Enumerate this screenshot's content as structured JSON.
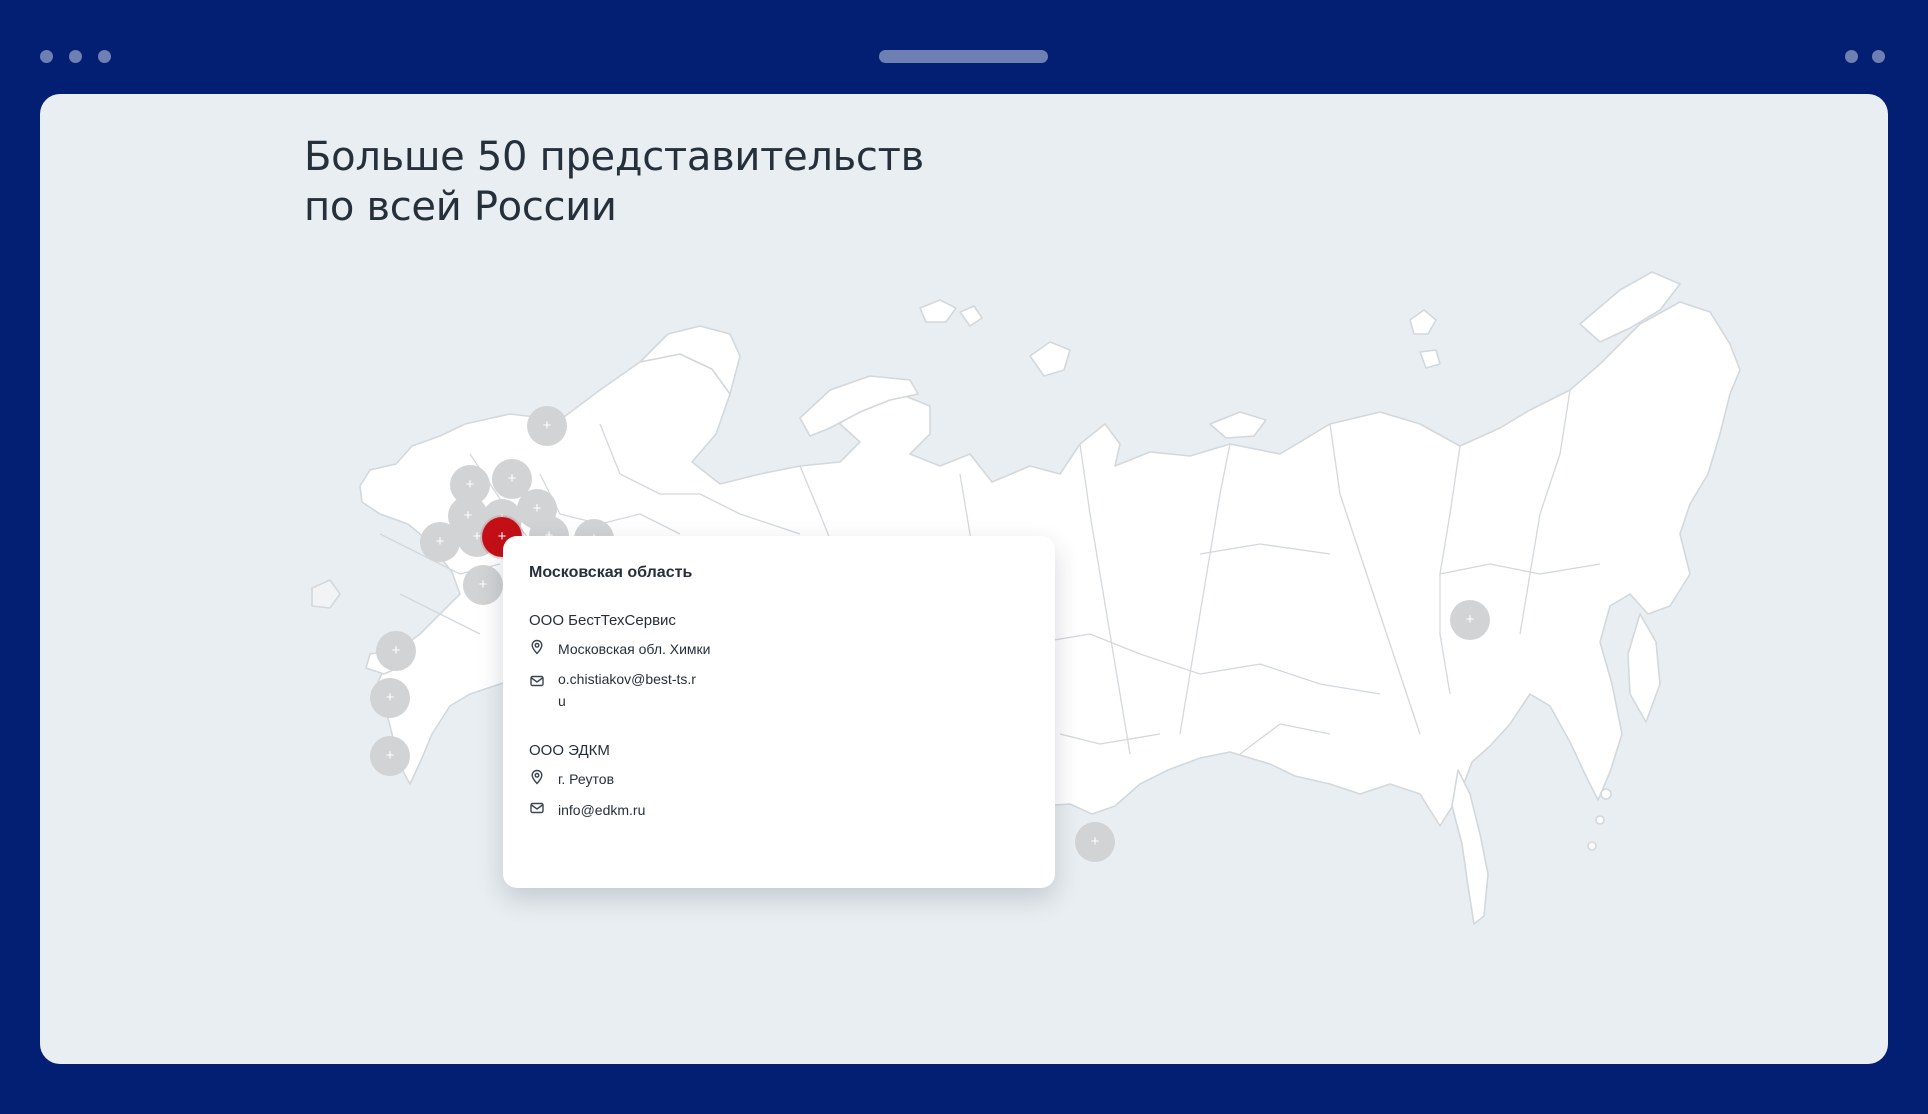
{
  "browser": {
    "controls": [
      "dot",
      "dot",
      "dot"
    ]
  },
  "page": {
    "heading_line1": "Больше 50 представительств",
    "heading_line2": "по всей России"
  },
  "map": {
    "markers_total": 16,
    "active_marker_region": "Московская область",
    "marker_icon": "plus-icon",
    "colors": {
      "land": "#ffffff",
      "border": "#d3d8dc",
      "marker": "#d1d3d5",
      "active": "#c40f17",
      "background": "#e8eef1"
    }
  },
  "popup": {
    "title": "Московская область",
    "companies": [
      {
        "name": "ООО БестТехСервис",
        "address": "Московская обл. Химки",
        "email": "o.chistiakov@best-ts.ru"
      },
      {
        "name": "ООО ЭДКМ",
        "address": "г. Реутов",
        "email": "info@edkm.ru"
      }
    ]
  },
  "icons": {
    "location": "location-pin-icon",
    "email": "envelope-icon"
  }
}
